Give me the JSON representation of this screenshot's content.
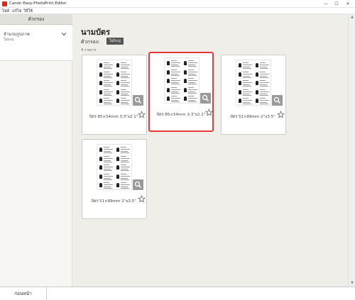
{
  "window": {
    "title": "Canon Easy-PhotoPrint Editor",
    "minimize_glyph": "—",
    "maximize_glyph": "☐",
    "close_glyph": "✕"
  },
  "menu": {
    "items": [
      "ไฟล์",
      "แก้ไข",
      "วิธีใช้"
    ]
  },
  "sidebar": {
    "header": "ตัวกรอง",
    "filter_label": "จำนวนรูปภาพ",
    "filter_value": "ไม่ระบุ"
  },
  "main": {
    "title": "นามบัตร",
    "filter_row_label": "ตัวกรอง:",
    "filter_chip": "ไม่ระบุ",
    "item_count": "4 รายการ"
  },
  "cards": [
    {
      "label": "บัตร 85×54mm 3.3\"x2.1\"",
      "selected": false,
      "favorite": false
    },
    {
      "label": "บัตร 85×54mm 3.3\"x2.1\"",
      "selected": true,
      "favorite": false
    },
    {
      "label": "บัตร 51×89mm 2\"x3.5\"",
      "selected": false,
      "favorite": false
    },
    {
      "label": "บัตร 51×89mm 2\"x3.5\"",
      "selected": false,
      "favorite": false
    }
  ],
  "bottom": {
    "back_label": "ก่อนหน้า"
  },
  "icons": {
    "magnify": "magnifier-icon",
    "star": "star-outline-icon",
    "chevron": "chevron-down-icon"
  },
  "colors": {
    "selection": "#e53935",
    "chip_bg": "#555555",
    "main_bg": "#f0eee8"
  }
}
